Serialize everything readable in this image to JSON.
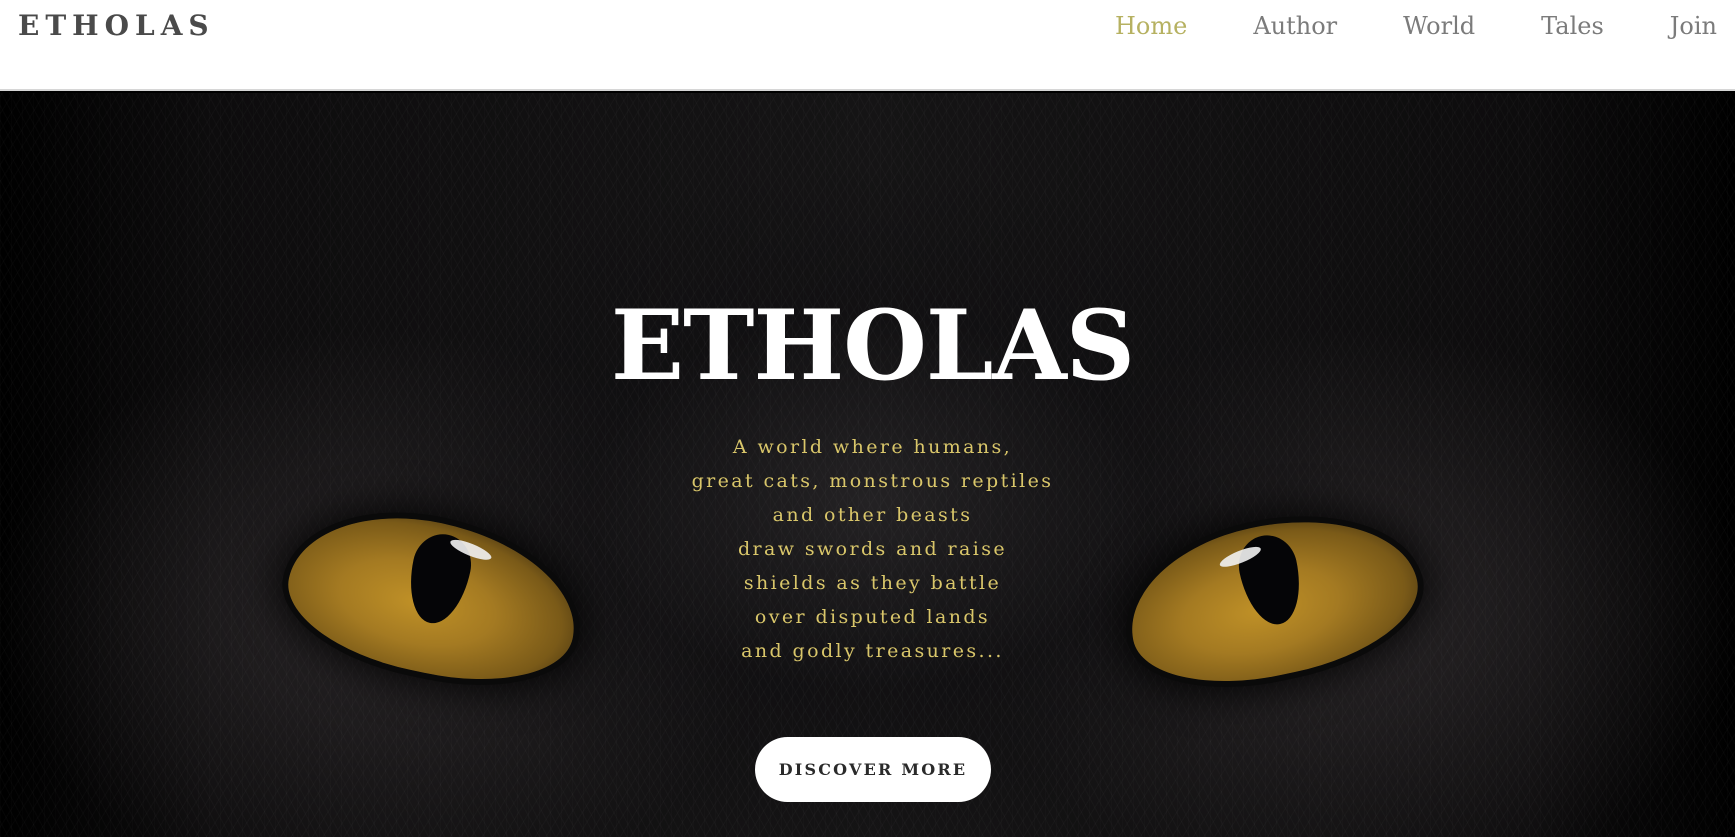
{
  "header": {
    "brand": "ETHOLAS",
    "nav": [
      {
        "label": "Home",
        "active": true
      },
      {
        "label": "Author",
        "active": false
      },
      {
        "label": "World",
        "active": false
      },
      {
        "label": "Tales",
        "active": false
      },
      {
        "label": "Join",
        "active": false
      }
    ]
  },
  "hero": {
    "title": "ETHOLAS",
    "tagline_lines": [
      "A world where humans,",
      "great cats, monstrous reptiles",
      "and other beasts",
      "draw swords and raise",
      "shields as they battle",
      "over disputed lands",
      "and godly treasures..."
    ],
    "cta_label": "DISCOVER MORE",
    "background_image": "black cat eyes close-up"
  },
  "colors": {
    "nav_active": "#b6b161",
    "nav_default": "#7b7b7b",
    "brand": "#4a4a4a",
    "tagline": "#d9c66a",
    "title": "#ffffff",
    "cta_bg": "#ffffff",
    "cta_text": "#2a2a2a"
  }
}
